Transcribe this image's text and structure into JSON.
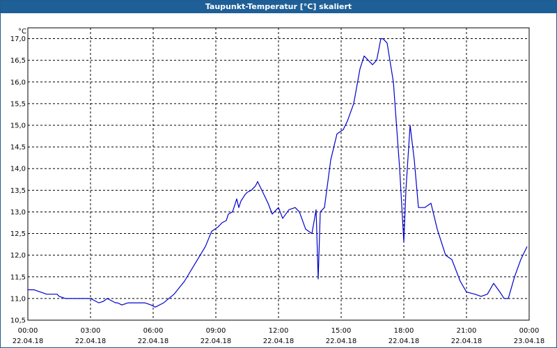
{
  "window": {
    "title": "Taupunkt-Temperatur [°C] skaliert"
  },
  "chart_data": {
    "type": "line",
    "title": "Taupunkt-Temperatur [°C] skaliert",
    "unit_label": "°C",
    "ylim": [
      10.5,
      17.25
    ],
    "xlim": [
      0,
      24
    ],
    "grid": true,
    "y_ticks": [
      10.5,
      11.0,
      11.5,
      12.0,
      12.5,
      13.0,
      13.5,
      14.0,
      14.5,
      15.0,
      15.5,
      16.0,
      16.5,
      17.0
    ],
    "y_tick_labels": [
      "10,5",
      "11,0",
      "11,5",
      "12,0",
      "12,5",
      "13,0",
      "13,5",
      "14,0",
      "14,5",
      "15,0",
      "15,5",
      "16,0",
      "16,5",
      "17,0"
    ],
    "x_ticks": [
      {
        "hour": 0,
        "time": "00:00",
        "date": "22.04.18"
      },
      {
        "hour": 3,
        "time": "03:00",
        "date": "22.04.18"
      },
      {
        "hour": 6,
        "time": "06:00",
        "date": "22.04.18"
      },
      {
        "hour": 9,
        "time": "09:00",
        "date": "22.04.18"
      },
      {
        "hour": 12,
        "time": "12:00",
        "date": "22.04.18"
      },
      {
        "hour": 15,
        "time": "15:00",
        "date": "22.04.18"
      },
      {
        "hour": 18,
        "time": "18:00",
        "date": "22.04.18"
      },
      {
        "hour": 21,
        "time": "21:00",
        "date": "22.04.18"
      },
      {
        "hour": 24,
        "time": "00:00",
        "date": "23.04.18"
      }
    ],
    "series": [
      {
        "color": "#0000cc",
        "x": [
          0,
          0.3,
          0.6,
          0.9,
          1.4,
          1.5,
          1.8,
          2.1,
          2.5,
          2.8,
          3.0,
          3.2,
          3.4,
          3.6,
          3.8,
          4.0,
          4.2,
          4.3,
          4.5,
          4.8,
          5.0,
          5.3,
          5.6,
          5.9,
          6.1,
          6.5,
          7.0,
          7.5,
          8.0,
          8.5,
          8.8,
          9.1,
          9.3,
          9.5,
          9.6,
          9.8,
          10.0,
          10.1,
          10.2,
          10.4,
          10.5,
          10.7,
          10.9,
          11.0,
          11.2,
          11.5,
          11.7,
          12.0,
          12.2,
          12.5,
          12.8,
          13.0,
          13.3,
          13.6,
          13.8,
          13.9,
          14.0,
          14.2,
          14.5,
          14.8,
          15.1,
          15.3,
          15.6,
          15.9,
          16.1,
          16.3,
          16.5,
          16.7,
          16.9,
          17.0,
          17.2,
          17.5,
          17.8,
          18.0,
          18.1,
          18.3,
          18.5,
          18.7,
          19.0,
          19.3,
          19.6,
          20.0,
          20.3,
          20.7,
          21.0,
          21.4,
          21.7,
          22.0,
          22.3,
          22.6,
          22.8,
          23.0,
          23.3,
          23.6,
          23.9
        ],
        "y": [
          11.2,
          11.2,
          11.15,
          11.1,
          11.1,
          11.05,
          11.0,
          11.0,
          11.0,
          11.0,
          11.0,
          10.95,
          10.9,
          10.93,
          11.0,
          10.95,
          10.9,
          10.9,
          10.85,
          10.9,
          10.9,
          10.9,
          10.9,
          10.85,
          10.8,
          10.9,
          11.1,
          11.4,
          11.8,
          12.2,
          12.55,
          12.65,
          12.75,
          12.8,
          12.95,
          13.0,
          13.3,
          13.1,
          13.25,
          13.4,
          13.45,
          13.5,
          13.6,
          13.7,
          13.5,
          13.2,
          12.95,
          13.1,
          12.85,
          13.05,
          13.1,
          13.0,
          12.6,
          12.5,
          13.05,
          11.45,
          13.0,
          13.1,
          14.2,
          14.8,
          14.9,
          15.1,
          15.5,
          16.3,
          16.6,
          16.5,
          16.4,
          16.5,
          17.0,
          17.0,
          16.9,
          16.0,
          14.0,
          12.3,
          13.5,
          15.0,
          14.2,
          13.1,
          13.1,
          13.2,
          12.6,
          12.0,
          11.9,
          11.4,
          11.15,
          11.1,
          11.05,
          11.1,
          11.35,
          11.15,
          11.0,
          11.0,
          11.5,
          11.9,
          12.2
        ]
      }
    ]
  }
}
